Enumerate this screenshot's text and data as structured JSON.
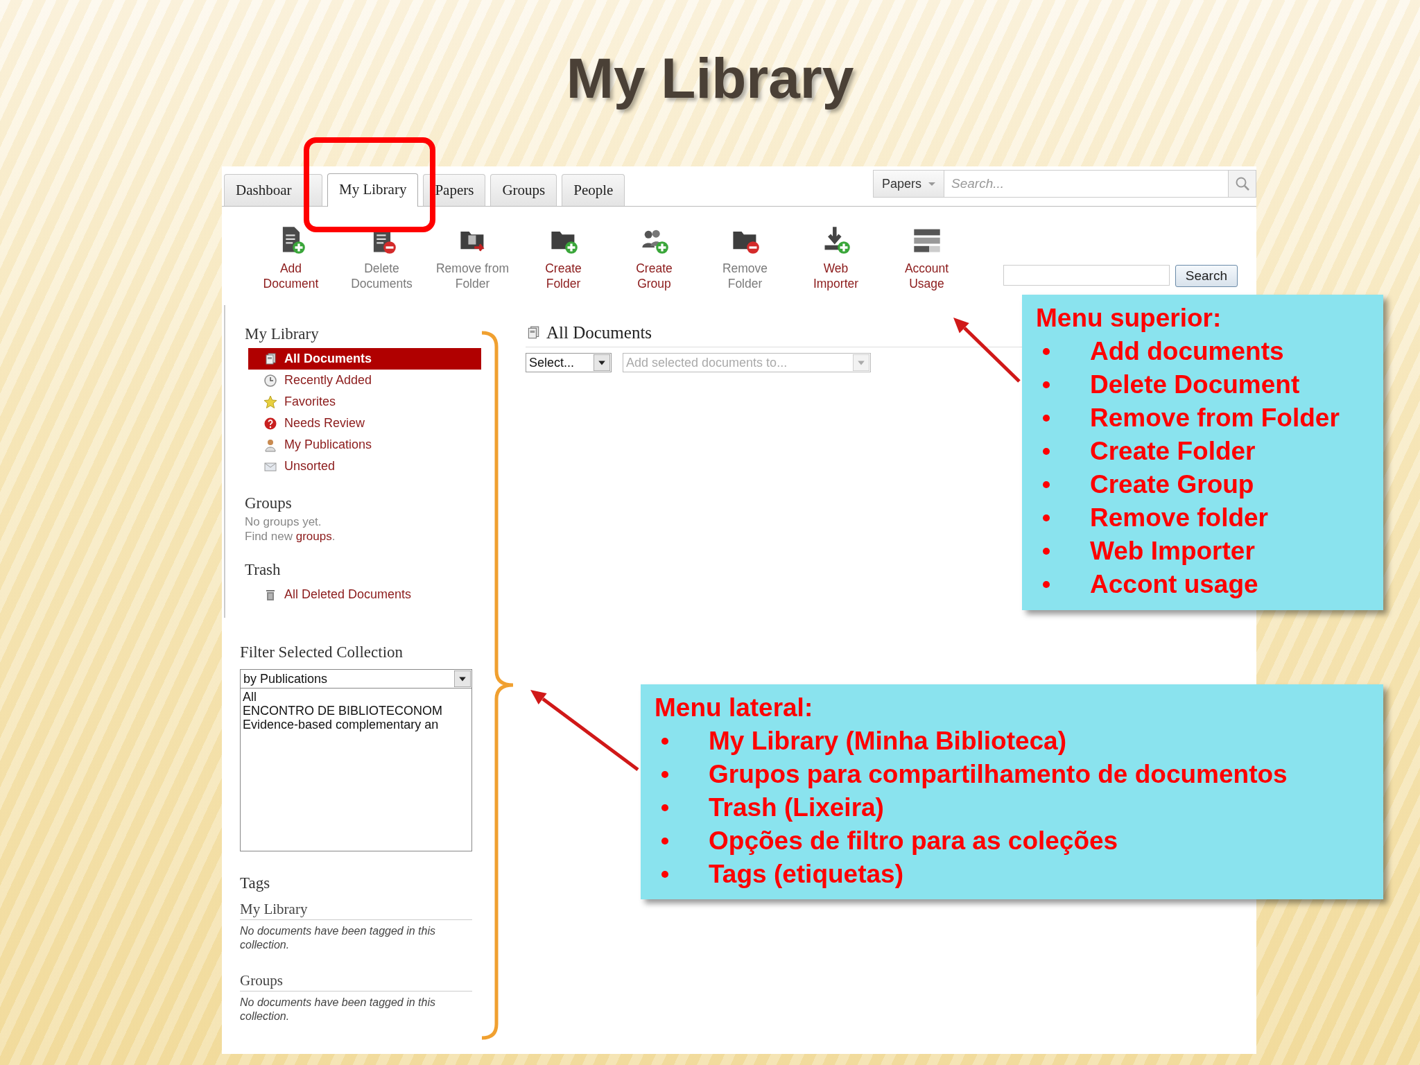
{
  "slide_title": "My Library",
  "tabs": [
    {
      "label": "Dashboar",
      "selected": false
    },
    {
      "label": "My Library",
      "selected": true
    },
    {
      "label": "Papers",
      "selected": false
    },
    {
      "label": "Groups",
      "selected": false
    },
    {
      "label": "People",
      "selected": false
    }
  ],
  "search": {
    "scope": "Papers",
    "placeholder": "Search..."
  },
  "toolbar": [
    {
      "kind": "add_document",
      "lines": [
        "Add",
        "Document"
      ],
      "disabled": false
    },
    {
      "kind": "delete_documents",
      "lines": [
        "Delete",
        "Documents"
      ],
      "disabled": true
    },
    {
      "kind": "remove_from_folder",
      "lines": [
        "Remove from",
        "Folder"
      ],
      "disabled": true
    },
    {
      "kind": "create_folder",
      "lines": [
        "Create",
        "Folder"
      ],
      "disabled": false
    },
    {
      "kind": "create_group",
      "lines": [
        "Create",
        "Group"
      ],
      "disabled": false
    },
    {
      "kind": "remove_folder",
      "lines": [
        "Remove",
        "Folder"
      ],
      "disabled": true
    },
    {
      "kind": "web_importer",
      "lines": [
        "Web",
        "Importer"
      ],
      "disabled": false
    },
    {
      "kind": "account_usage",
      "lines": [
        "Account",
        "Usage"
      ],
      "disabled": false
    }
  ],
  "toolbar_search": {
    "button": "Search"
  },
  "sidebar": {
    "my_library": {
      "heading": "My Library",
      "items": [
        {
          "kind": "all_documents",
          "label": "All Documents",
          "selected": true
        },
        {
          "kind": "recent",
          "label": "Recently Added",
          "selected": false
        },
        {
          "kind": "favorites",
          "label": "Favorites",
          "selected": false
        },
        {
          "kind": "review",
          "label": "Needs Review",
          "selected": false
        },
        {
          "kind": "publications",
          "label": "My Publications",
          "selected": false
        },
        {
          "kind": "unsorted",
          "label": "Unsorted",
          "selected": false
        }
      ]
    },
    "groups": {
      "heading": "Groups",
      "empty_text": "No groups yet.",
      "find_text": "Find new",
      "find_link": "groups",
      "find_end": "."
    },
    "trash": {
      "heading": "Trash",
      "items": [
        {
          "kind": "deleted",
          "label": "All Deleted Documents",
          "selected": false
        }
      ]
    },
    "filter": {
      "heading": "Filter Selected Collection",
      "value": "by Publications",
      "options": [
        "All",
        "ENCONTRO DE BIBLIOTECONOM",
        "Evidence-based complementary an"
      ]
    },
    "tags": {
      "heading": "Tags",
      "sections": [
        {
          "heading": "My Library",
          "note": "No documents have been tagged in this collection."
        },
        {
          "heading": "Groups",
          "note": "No documents have been tagged in this collection."
        }
      ]
    }
  },
  "main": {
    "heading": "All Documents",
    "select": "Select...",
    "add_to": {
      "placeholder": "Add selected documents to...",
      "disabled": true
    }
  },
  "callouts": [
    {
      "title": "Menu superior:",
      "items": [
        "Add documents",
        "Delete Document",
        "Remove from Folder",
        "Create Folder",
        "Create Group",
        "Remove folder",
        "Web Importer",
        "Accont usage"
      ]
    },
    {
      "title": "Menu lateral:",
      "items": [
        "My Library (Minha Biblioteca)",
        "Grupos para compartilhamento de documentos",
        "Trash (Lixeira)",
        "Opções de filtro para as coleções",
        "Tags (etiquetas)"
      ]
    }
  ]
}
